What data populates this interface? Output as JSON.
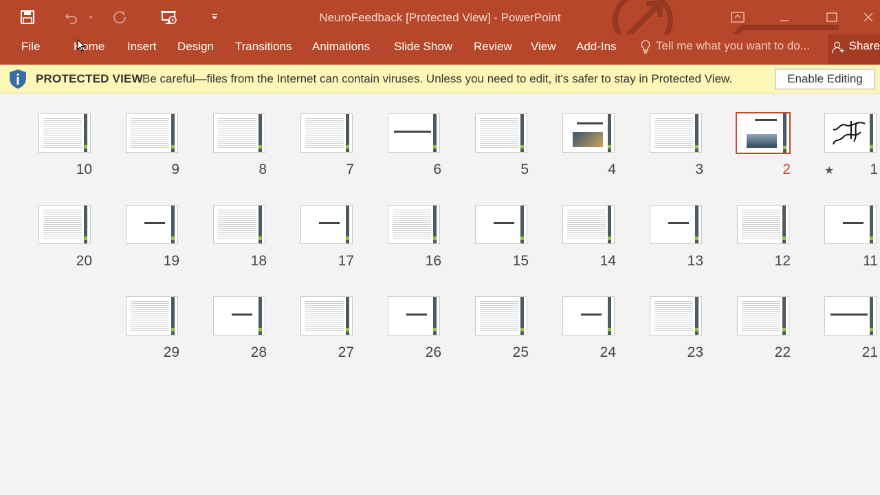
{
  "window": {
    "title": "NeuroFeedback [Protected View] - PowerPoint"
  },
  "qat": {
    "icons": [
      "save-icon",
      "undo-icon",
      "redo-icon",
      "slideshow-from-start-icon",
      "customize-qat-icon"
    ]
  },
  "ribbon": {
    "tabs": [
      "File",
      "Home",
      "Insert",
      "Design",
      "Transitions",
      "Animations",
      "Slide Show",
      "Review",
      "View",
      "Add-Ins"
    ],
    "tell_me": "Tell me what you want to do...",
    "share": "Share"
  },
  "protected_view": {
    "title": "PROTECTED VIEW",
    "message": "Be careful—files from the Internet can contain viruses. Unless you need to edit, it's safer to stay in Protected View.",
    "button": "Enable Editing"
  },
  "slides": {
    "selected": "2",
    "items": [
      {
        "n": "10",
        "kind": "text"
      },
      {
        "n": "9",
        "kind": "text"
      },
      {
        "n": "8",
        "kind": "text"
      },
      {
        "n": "7",
        "kind": "text"
      },
      {
        "n": "6",
        "kind": "title"
      },
      {
        "n": "5",
        "kind": "text"
      },
      {
        "n": "4",
        "kind": "picture"
      },
      {
        "n": "3",
        "kind": "text"
      },
      {
        "n": "2",
        "kind": "picture"
      },
      {
        "n": "1",
        "kind": "calligraphy"
      },
      {
        "n": "20",
        "kind": "text"
      },
      {
        "n": "19",
        "kind": "title"
      },
      {
        "n": "18",
        "kind": "text"
      },
      {
        "n": "17",
        "kind": "title"
      },
      {
        "n": "16",
        "kind": "text"
      },
      {
        "n": "15",
        "kind": "title"
      },
      {
        "n": "14",
        "kind": "text"
      },
      {
        "n": "13",
        "kind": "title"
      },
      {
        "n": "12",
        "kind": "text"
      },
      {
        "n": "11",
        "kind": "title"
      },
      {
        "n": "29",
        "kind": "text"
      },
      {
        "n": "28",
        "kind": "title"
      },
      {
        "n": "27",
        "kind": "text"
      },
      {
        "n": "26",
        "kind": "title"
      },
      {
        "n": "25",
        "kind": "text"
      },
      {
        "n": "24",
        "kind": "title"
      },
      {
        "n": "23",
        "kind": "text"
      },
      {
        "n": "22",
        "kind": "text"
      },
      {
        "n": "21",
        "kind": "title"
      }
    ]
  },
  "colors": {
    "accent": "#b7472a",
    "selected": "#c4472c",
    "banner": "#fcf7b6"
  }
}
